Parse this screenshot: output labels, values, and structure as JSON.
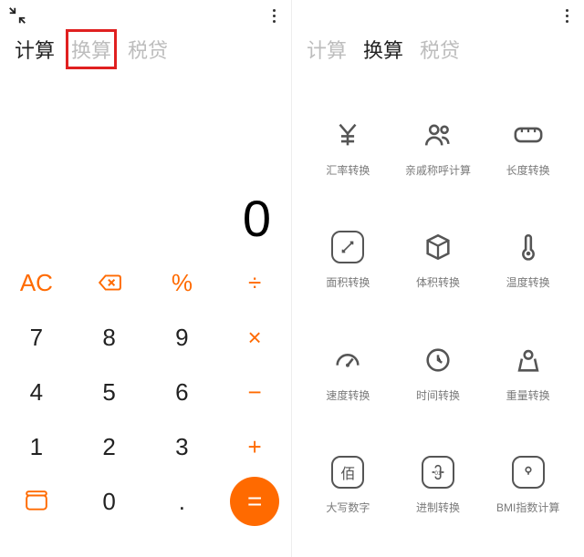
{
  "left": {
    "tabs": [
      "计算",
      "换算",
      "税贷"
    ],
    "active_tab": 0,
    "highlight_tab": 1,
    "display": "0",
    "keypad": [
      [
        {
          "name": "ac-key",
          "label": "AC",
          "icon": null,
          "accent": true
        },
        {
          "name": "backspace-key",
          "label": null,
          "icon": "backspace",
          "accent": true
        },
        {
          "name": "percent-key",
          "label": "%",
          "icon": null,
          "accent": true
        },
        {
          "name": "divide-key",
          "label": "÷",
          "icon": null,
          "accent": true
        }
      ],
      [
        {
          "name": "key-7",
          "label": "7",
          "icon": null,
          "accent": false
        },
        {
          "name": "key-8",
          "label": "8",
          "icon": null,
          "accent": false
        },
        {
          "name": "key-9",
          "label": "9",
          "icon": null,
          "accent": false
        },
        {
          "name": "multiply-key",
          "label": "×",
          "icon": null,
          "accent": true
        }
      ],
      [
        {
          "name": "key-4",
          "label": "4",
          "icon": null,
          "accent": false
        },
        {
          "name": "key-5",
          "label": "5",
          "icon": null,
          "accent": false
        },
        {
          "name": "key-6",
          "label": "6",
          "icon": null,
          "accent": false
        },
        {
          "name": "minus-key",
          "label": "−",
          "icon": null,
          "accent": true
        }
      ],
      [
        {
          "name": "key-1",
          "label": "1",
          "icon": null,
          "accent": false
        },
        {
          "name": "key-2",
          "label": "2",
          "icon": null,
          "accent": false
        },
        {
          "name": "key-3",
          "label": "3",
          "icon": null,
          "accent": false
        },
        {
          "name": "plus-key",
          "label": "+",
          "icon": null,
          "accent": true
        }
      ],
      [
        {
          "name": "expand-key",
          "label": null,
          "icon": "expand",
          "accent": true
        },
        {
          "name": "key-0",
          "label": "0",
          "icon": null,
          "accent": false
        },
        {
          "name": "dot-key",
          "label": ".",
          "icon": null,
          "accent": false
        },
        {
          "name": "equals-key",
          "label": "=",
          "icon": "equals",
          "accent": true
        }
      ]
    ]
  },
  "right": {
    "tabs": [
      "计算",
      "换算",
      "税贷"
    ],
    "active_tab": 1,
    "items": [
      {
        "name": "currency-exchange",
        "icon": "yen",
        "label": "汇率转换"
      },
      {
        "name": "relative-calc",
        "icon": "people",
        "label": "亲戚称呼计算"
      },
      {
        "name": "length-convert",
        "icon": "ruler",
        "label": "长度转换"
      },
      {
        "name": "area-convert",
        "icon": "area",
        "label": "面积转换"
      },
      {
        "name": "volume-convert",
        "icon": "cube",
        "label": "体积转换"
      },
      {
        "name": "temperature-convert",
        "icon": "thermometer",
        "label": "温度转换"
      },
      {
        "name": "speed-convert",
        "icon": "gauge",
        "label": "速度转换"
      },
      {
        "name": "time-convert",
        "icon": "clock",
        "label": "时间转换"
      },
      {
        "name": "weight-convert",
        "icon": "weight",
        "label": "重量转换"
      },
      {
        "name": "capital-number",
        "icon": "bai",
        "label": "大写数字"
      },
      {
        "name": "base-convert",
        "icon": "binary",
        "label": "进制转换"
      },
      {
        "name": "bmi-calc",
        "icon": "bmi",
        "label": "BMI指数计算"
      }
    ]
  }
}
